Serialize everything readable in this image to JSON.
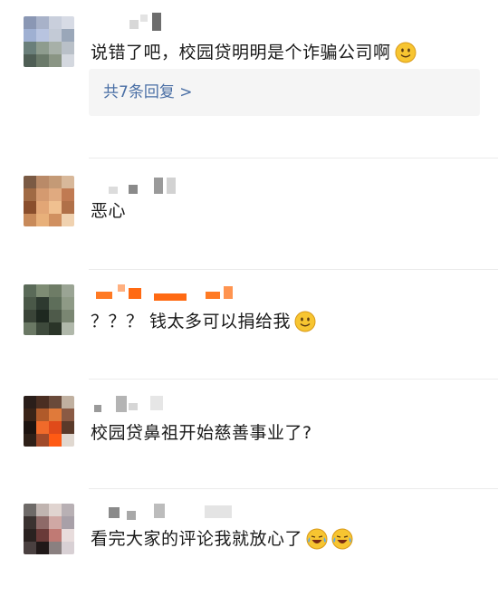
{
  "comments": [
    {
      "text": "说错了吧，校园贷明明是个诈骗公司啊",
      "emoji": [
        "smile-emoji"
      ],
      "replies_label": "共7条回复 >"
    },
    {
      "text": "恶心",
      "emoji": []
    },
    {
      "text": "？？？ 钱太多可以捐给我",
      "emoji": [
        "smile-emoji"
      ]
    },
    {
      "text": "校园贷鼻祖开始慈善事业了?",
      "emoji": []
    },
    {
      "text": "看完大家的评论我就放心了",
      "emoji": [
        "tears-of-joy-emoji",
        "tears-of-joy-emoji"
      ]
    }
  ],
  "colors": {
    "reply_link": "#4a6fa5",
    "divider": "#ebebeb",
    "reply_box": "#f5f5f5",
    "username_orange": "#ff6a13"
  }
}
